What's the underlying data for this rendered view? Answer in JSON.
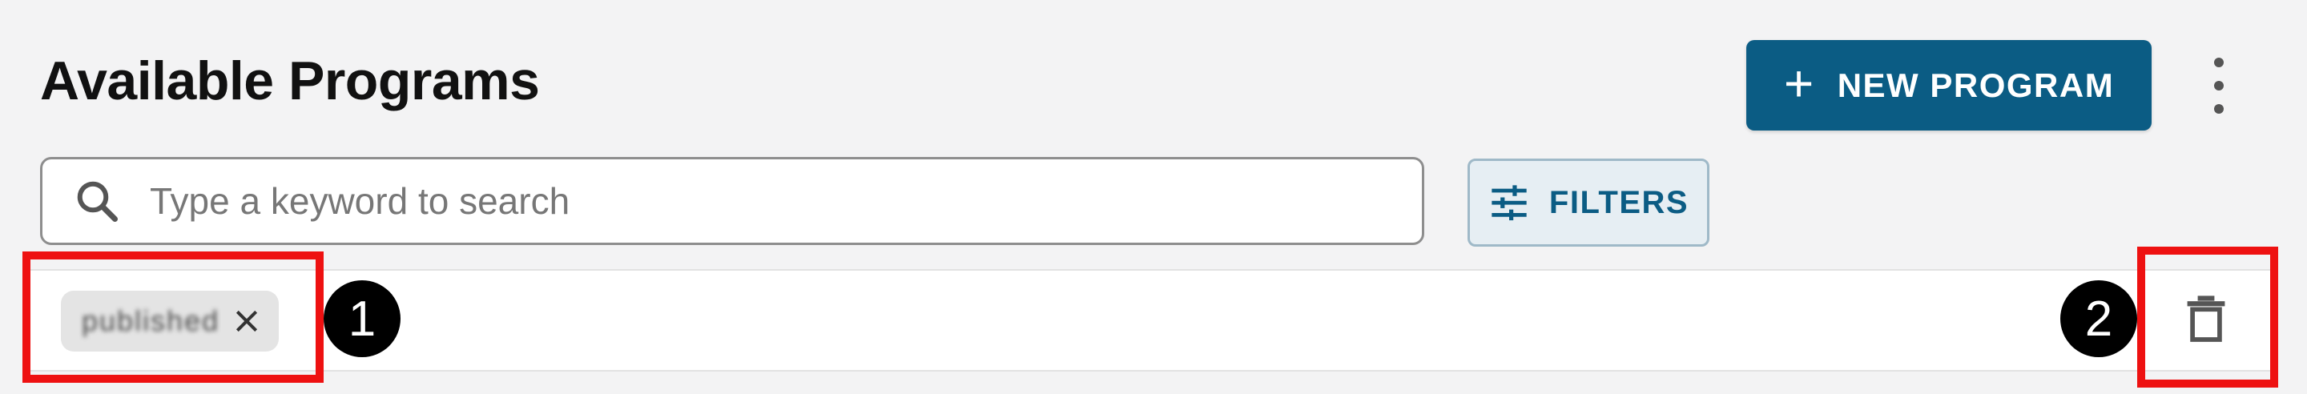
{
  "header": {
    "title": "Available Programs",
    "new_program_label": "NEW PROGRAM",
    "new_program_icon": "plus-icon",
    "menu_icon": "more-vert-icon"
  },
  "search": {
    "placeholder": "Type a keyword to search",
    "value": "",
    "icon": "search-icon"
  },
  "filters": {
    "label": "FILTERS",
    "icon": "tune-icon"
  },
  "active_filters": {
    "chips": [
      {
        "label": "published",
        "remove_icon": "close-icon"
      }
    ],
    "clear_icon": "trash-icon"
  },
  "annotations": [
    {
      "number": "1",
      "color": "#ee1111"
    },
    {
      "number": "2",
      "color": "#ee1111"
    }
  ],
  "colors": {
    "accent": "#0b5c84",
    "filters_bg": "#e6eef3",
    "highlight": "#ee1111"
  }
}
